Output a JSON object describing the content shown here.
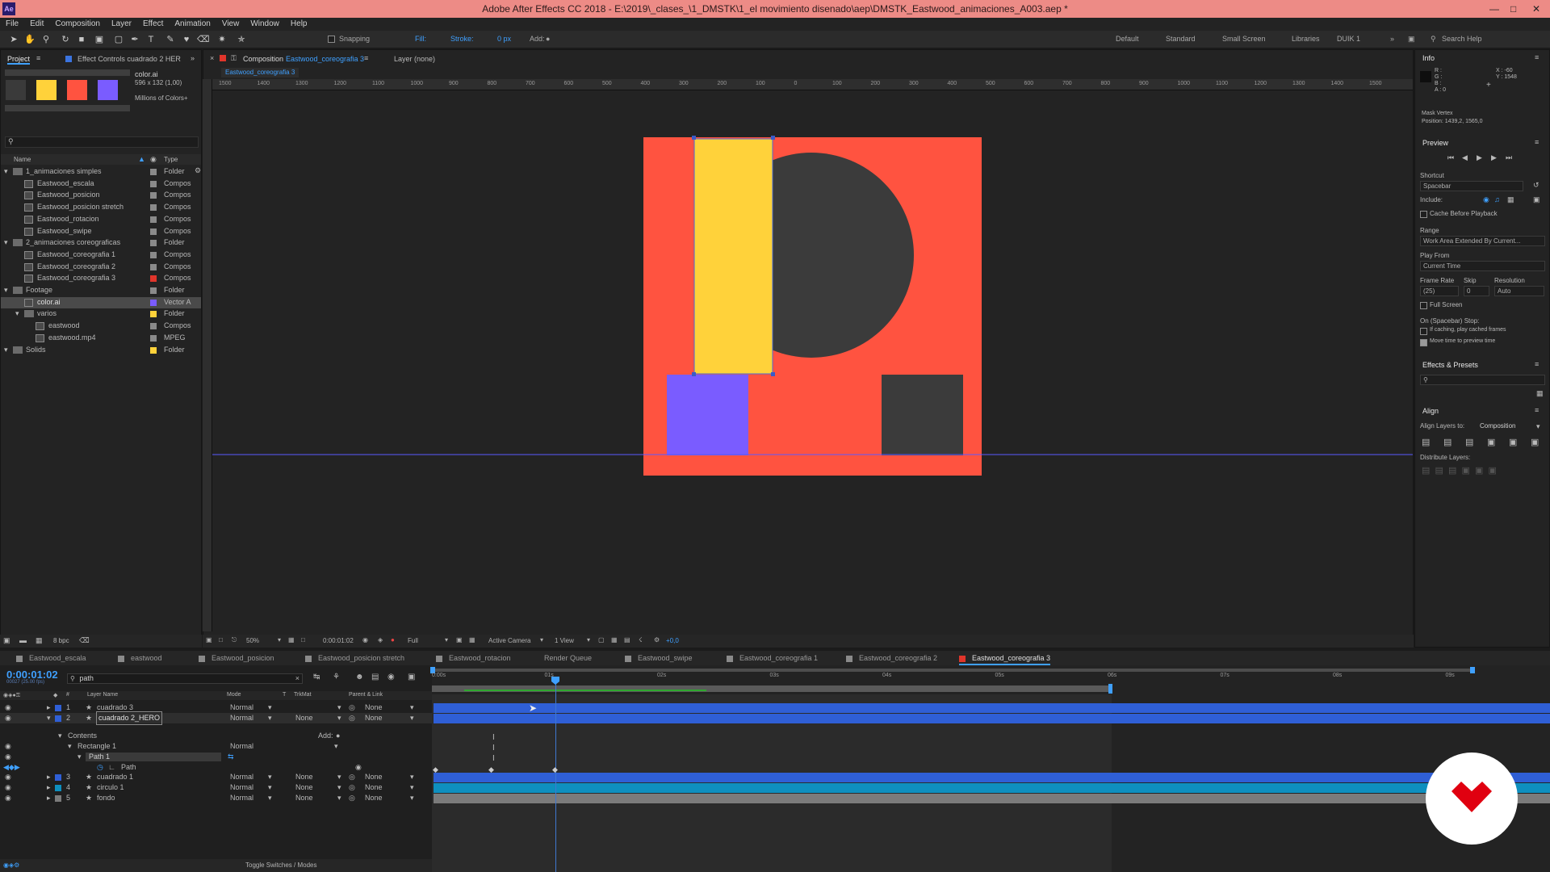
{
  "window": {
    "title": "Adobe After Effects CC 2018 - E:\\2019\\_clases_\\1_DMSTK\\1_el movimiento disenado\\aep\\DMSTK_Eastwood_animaciones_A003.aep *",
    "app_icon": "Ae"
  },
  "menu": [
    "File",
    "Edit",
    "Composition",
    "Layer",
    "Effect",
    "Animation",
    "View",
    "Window",
    "Help"
  ],
  "toolbar": {
    "snapping": "Snapping",
    "fill": "Fill:",
    "stroke": "Stroke:",
    "stroke_px": "0 px",
    "add": "Add:",
    "workspaces": [
      "Default",
      "Standard",
      "Small Screen",
      "Libraries",
      "DUIK 1"
    ],
    "search": "Search Help"
  },
  "project": {
    "tab": "Project",
    "effect_tab": "Effect Controls cuadrado 2 HER",
    "item_name": "color.ai",
    "item_size": "596 x 132 (1,00)",
    "item_colors": "Millions of Colors+",
    "swatches": [
      "#3a3a3a",
      "#ffd23a",
      "#ff5340",
      "#7a5cff"
    ],
    "bpc": "8 bpc",
    "col_name": "Name",
    "col_type": "Type",
    "rows": [
      {
        "name": "1_animaciones simples",
        "type": "Folder",
        "indent": 0,
        "kind": "folder",
        "label": "#8a8a8a"
      },
      {
        "name": "Eastwood_escala",
        "type": "Compos",
        "indent": 1,
        "kind": "comp",
        "label": "#8a8a8a"
      },
      {
        "name": "Eastwood_posicion",
        "type": "Compos",
        "indent": 1,
        "kind": "comp",
        "label": "#8a8a8a"
      },
      {
        "name": "Eastwood_posicion stretch",
        "type": "Compos",
        "indent": 1,
        "kind": "comp",
        "label": "#8a8a8a"
      },
      {
        "name": "Eastwood_rotacion",
        "type": "Compos",
        "indent": 1,
        "kind": "comp",
        "label": "#8a8a8a"
      },
      {
        "name": "Eastwood_swipe",
        "type": "Compos",
        "indent": 1,
        "kind": "comp",
        "label": "#8a8a8a"
      },
      {
        "name": "2_animaciones coreograficas",
        "type": "Folder",
        "indent": 0,
        "kind": "folder",
        "label": "#8a8a8a"
      },
      {
        "name": "Eastwood_coreografia 1",
        "type": "Compos",
        "indent": 1,
        "kind": "comp",
        "label": "#8a8a8a"
      },
      {
        "name": "Eastwood_coreografia 2",
        "type": "Compos",
        "indent": 1,
        "kind": "comp",
        "label": "#8a8a8a"
      },
      {
        "name": "Eastwood_coreografia 3",
        "type": "Compos",
        "indent": 1,
        "kind": "comp",
        "label": "#e0352b"
      },
      {
        "name": "Footage",
        "type": "Folder",
        "indent": 0,
        "kind": "folder",
        "label": "#8a8a8a"
      },
      {
        "name": "color.ai",
        "type": "Vector A",
        "indent": 1,
        "kind": "file",
        "label": "#7a5cff",
        "selected": true
      },
      {
        "name": "varios",
        "type": "Folder",
        "indent": 1,
        "kind": "folder",
        "label": "#ffd23a"
      },
      {
        "name": "eastwood",
        "type": "Compos",
        "indent": 2,
        "kind": "comp",
        "label": "#8a8a8a"
      },
      {
        "name": "eastwood.mp4",
        "type": "MPEG",
        "indent": 2,
        "kind": "file",
        "label": "#8a8a8a"
      },
      {
        "name": "Solids",
        "type": "Folder",
        "indent": 0,
        "kind": "folder",
        "label": "#ffd23a"
      }
    ]
  },
  "composition": {
    "tab_prefix": "Composition",
    "tab_name": "Eastwood_coreografia 3",
    "layer_tab": "Layer (none)",
    "breadcrumb": "Eastwood_coreografia 3",
    "ruler_labels": [
      "1500",
      "1400",
      "1300",
      "1200",
      "1100",
      "1000",
      "900",
      "800",
      "700",
      "600",
      "500",
      "400",
      "300",
      "200",
      "100",
      "0",
      "100",
      "200",
      "300",
      "400",
      "500",
      "600",
      "700",
      "800",
      "900",
      "1000",
      "1100",
      "1200",
      "1300",
      "1400",
      "1500"
    ],
    "footer": {
      "zoom": "50%",
      "time": "0:00:01:02",
      "resolution": "Full",
      "camera": "Active Camera",
      "views": "1 View",
      "exposure": "+0,0"
    },
    "colors": {
      "bg": "#ff5340",
      "circle": "#3b3b3b",
      "yellow": "#ffd23a",
      "purple": "#7a5cff",
      "dark": "#3b3b3b",
      "guide": "#5a5aff"
    }
  },
  "info": {
    "title": "Info",
    "r": "R :",
    "g": "G :",
    "b": "B :",
    "a": "A : 0",
    "x": "X : -60",
    "y": "Y : 1548",
    "line1": "Mask Vertex",
    "line2": "Position: 1439,2, 1565,0"
  },
  "preview": {
    "title": "Preview",
    "shortcut_label": "Shortcut",
    "shortcut": "Spacebar",
    "include": "Include:",
    "cache": "Cache Before Playback",
    "range_label": "Range",
    "range": "Work Area Extended By Current...",
    "playfrom_label": "Play From",
    "playfrom": "Current Time",
    "fr_label": "Frame Rate",
    "skip_label": "Skip",
    "res_label": "Resolution",
    "fr": "(25)",
    "skip": "0",
    "res": "Auto",
    "fullscreen": "Full Screen",
    "stop_label": "On (Spacebar) Stop:",
    "stop1": "If caching, play cached frames",
    "stop2": "Move time to preview time"
  },
  "effects": {
    "title": "Effects & Presets"
  },
  "align": {
    "title": "Align",
    "align_to_label": "Align Layers to:",
    "align_to": "Composition",
    "distribute": "Distribute Layers:"
  },
  "timeline": {
    "tabs": [
      {
        "name": "Eastwood_escala",
        "color": "#8a8a8a"
      },
      {
        "name": "eastwood",
        "color": "#8a8a8a"
      },
      {
        "name": "Eastwood_posicion",
        "color": "#8a8a8a"
      },
      {
        "name": "Eastwood_posicion stretch",
        "color": "#8a8a8a"
      },
      {
        "name": "Eastwood_rotacion",
        "color": "#8a8a8a"
      },
      {
        "name": "Render Queue",
        "color": ""
      },
      {
        "name": "Eastwood_swipe",
        "color": "#8a8a8a"
      },
      {
        "name": "Eastwood_coreografia 1",
        "color": "#8a8a8a"
      },
      {
        "name": "Eastwood_coreografia 2",
        "color": "#8a8a8a"
      },
      {
        "name": "Eastwood_coreografia 3",
        "color": "#e0352b",
        "active": true
      }
    ],
    "timecode": "0:00:01:02",
    "frames": "00027 (25.00 fps)",
    "search": "path",
    "cols": {
      "layer": "Layer Name",
      "mode": "Mode",
      "t": "T",
      "trkmat": "TrkMat",
      "parent": "Parent & Link"
    },
    "ruler": [
      "0:00s",
      "01s",
      "02s",
      "03s",
      "04s",
      "05s",
      "06s",
      "07s",
      "08s",
      "09s"
    ],
    "layers": [
      {
        "num": "1",
        "name": "cuadrado 3",
        "mode": "Normal",
        "trk": "",
        "parent": "None",
        "color": "#2f5fd6"
      },
      {
        "num": "2",
        "name": "cuadrado 2_HERO",
        "mode": "Normal",
        "trk": "None",
        "parent": "None",
        "color": "#2f5fd6",
        "selected": true
      },
      {
        "num": "3",
        "name": "cuadrado 1",
        "mode": "Normal",
        "trk": "None",
        "parent": "None",
        "color": "#2f5fd6"
      },
      {
        "num": "4",
        "name": "circulo 1",
        "mode": "Normal",
        "trk": "None",
        "parent": "None",
        "color": "#0e8fbf"
      },
      {
        "num": "5",
        "name": "fondo",
        "mode": "Normal",
        "trk": "None",
        "parent": "None",
        "color": "#7b7b7b"
      }
    ],
    "contents": "Contents",
    "add": "Add:",
    "rect": "Rectangle 1",
    "rect_mode": "Normal",
    "path1": "Path 1",
    "path": "Path",
    "toggle": "Toggle Switches / Modes"
  }
}
